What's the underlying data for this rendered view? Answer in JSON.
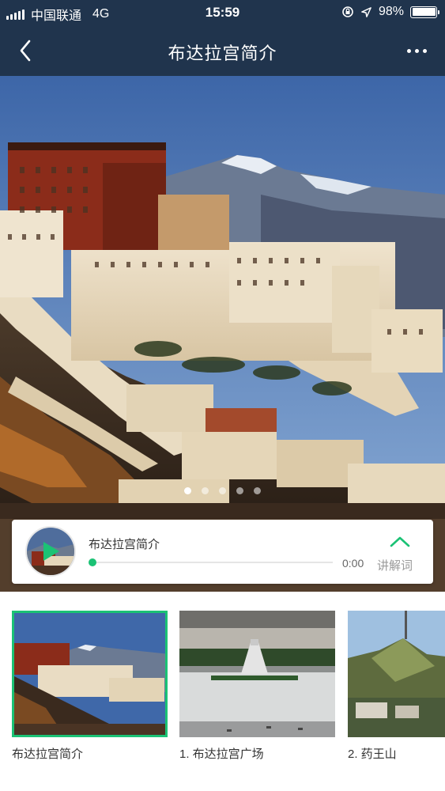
{
  "status_bar": {
    "carrier": "中国联通",
    "network": "4G",
    "time": "15:59",
    "battery": "98%"
  },
  "nav": {
    "title": "布达拉宫简介",
    "back_icon": "chevron-left-icon",
    "more_icon": "more-horizontal-icon"
  },
  "carousel": {
    "page_count": 5,
    "active_index": 0
  },
  "player": {
    "title": "布达拉宫简介",
    "current_time": "0:00",
    "progress": 0,
    "lyrics_label": "讲解词",
    "lyrics_icon": "chevron-up-icon",
    "play_icon": "play-icon"
  },
  "spots": [
    {
      "label": "布达拉宫简介",
      "active": true
    },
    {
      "label": "1. 布达拉宫广场",
      "active": false
    },
    {
      "label": "2. 药王山",
      "active": false
    }
  ],
  "colors": {
    "header": "#20344d",
    "accent": "#1bc275"
  }
}
